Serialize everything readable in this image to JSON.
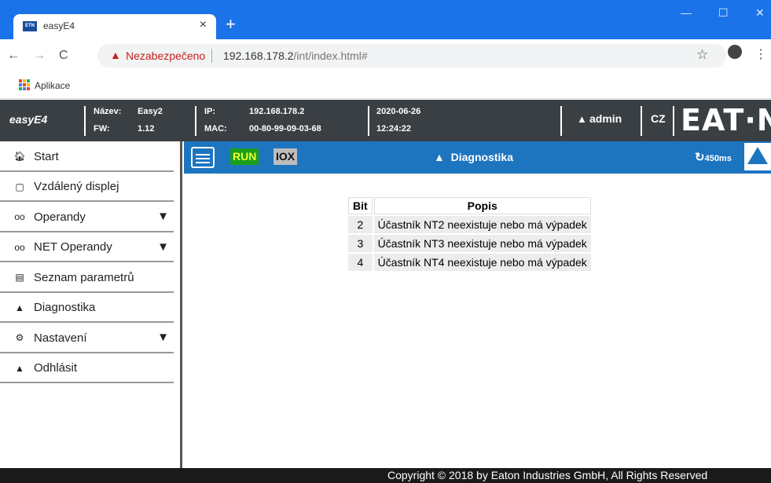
{
  "browser": {
    "tab_title": "easyE4",
    "tab_favicon_text": "ETN",
    "insecure_label": "Nezabezpečeno",
    "url_host": "192.168.178.2",
    "url_path": "/int/index.html#",
    "bookmark_apps": "Aplikace"
  },
  "header": {
    "app_title": "easyE4",
    "name_label": "Název:",
    "name_value": "Easy2",
    "fw_label": "FW:",
    "fw_value": "1.12",
    "ip_label": "IP:",
    "ip_value": "192.168.178.2",
    "mac_label": "MAC:",
    "mac_value": "00-80-99-09-03-68",
    "date": "2020-06-26",
    "time": "12:24:22",
    "user": "admin",
    "language": "CZ",
    "logo": "EAT·N"
  },
  "sidebar": {
    "items": [
      {
        "label": "Start",
        "icon": "home-icon"
      },
      {
        "label": "Vzdálený displej",
        "icon": "monitor-icon"
      },
      {
        "label": "Operandy",
        "icon": "glasses-icon"
      },
      {
        "label": "NET Operandy",
        "icon": "glasses-icon"
      },
      {
        "label": "Seznam parametrů",
        "icon": "list-icon"
      },
      {
        "label": "Diagnostika",
        "icon": "warning-icon"
      },
      {
        "label": "Nastavení",
        "icon": "gear-icon"
      },
      {
        "label": "Odhlásit",
        "icon": "user-icon"
      }
    ]
  },
  "toolbar": {
    "run": "RUN",
    "iox": "IOX",
    "title": "Diagnostika",
    "cycle": "450ms"
  },
  "table": {
    "headers": [
      "Bit",
      "Popis"
    ],
    "rows": [
      {
        "bit": "2",
        "desc": "Účastník NT2 neexistuje nebo má výpadek"
      },
      {
        "bit": "3",
        "desc": "Účastník NT3 neexistuje nebo má výpadek"
      },
      {
        "bit": "4",
        "desc": "Účastník NT4 neexistuje nebo má výpadek"
      }
    ]
  },
  "footer": "Copyright © 2018 by Eaton Industries GmbH, All Rights Reserved",
  "colors": {
    "browser_accent": "#1a73e8",
    "header_bg": "#3a3f44",
    "toolbar_bg": "#1d75c0",
    "run_bg": "#1a9f1a"
  }
}
